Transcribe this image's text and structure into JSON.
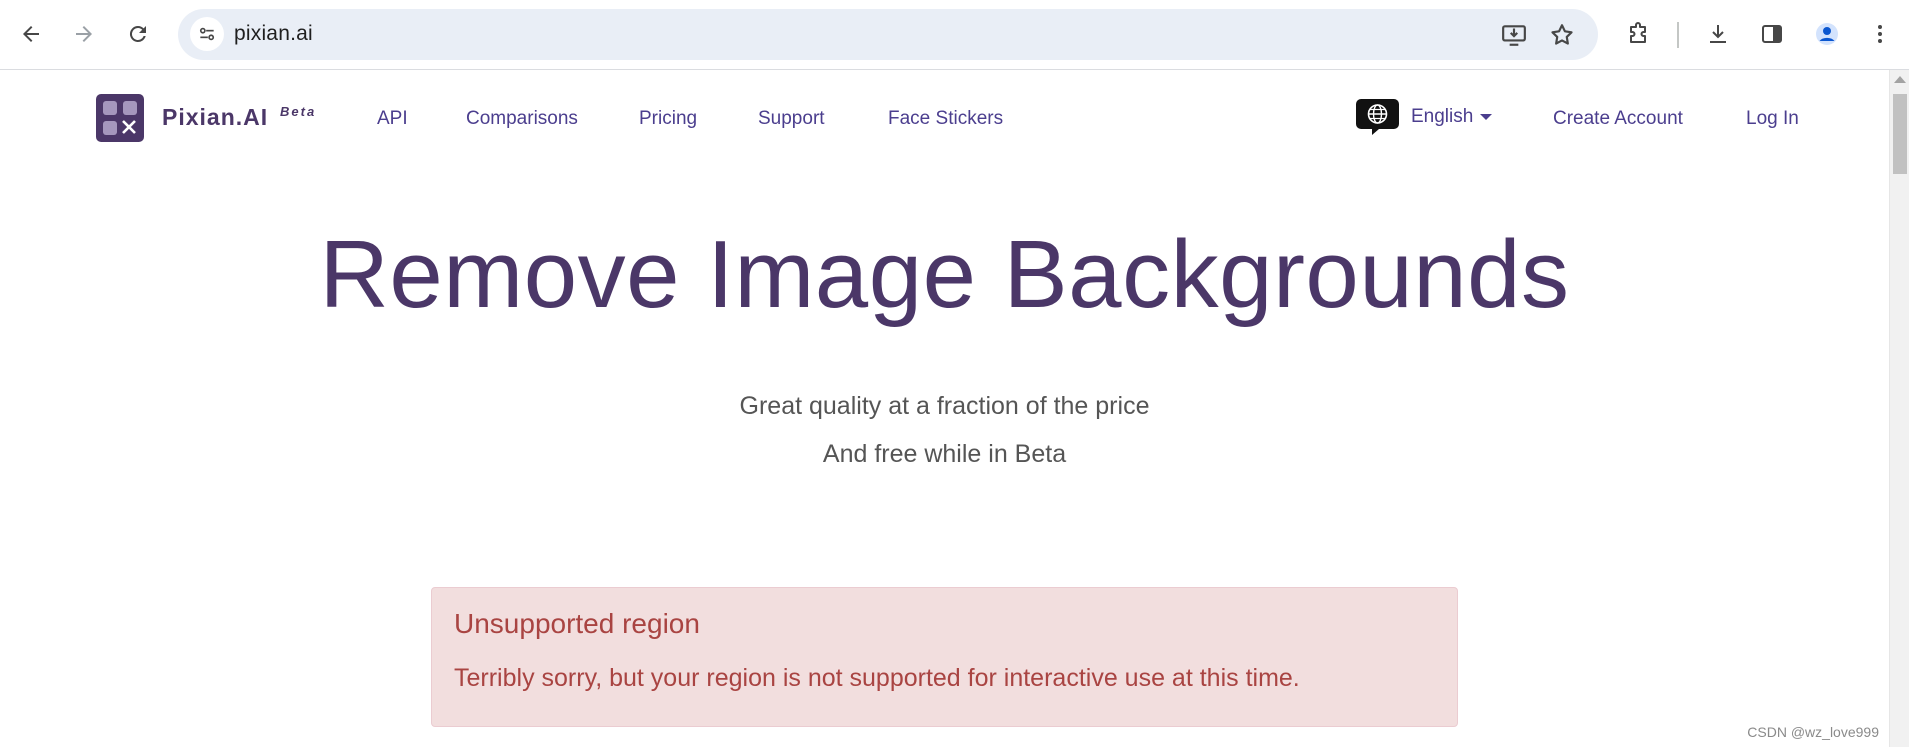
{
  "browser": {
    "url": "pixian.ai",
    "back_icon": "arrow-left-icon",
    "forward_icon": "arrow-right-icon",
    "reload_icon": "reload-icon"
  },
  "site": {
    "brand": "Pixian.AI",
    "brand_badge": "Beta",
    "nav": {
      "api": "API",
      "comparisons": "Comparisons",
      "pricing": "Pricing",
      "support": "Support",
      "face_stickers": "Face Stickers"
    },
    "language": "English",
    "create_account": "Create Account",
    "login": "Log In"
  },
  "hero": {
    "title": "Remove Image Backgrounds",
    "subtitle_1": "Great quality at a fraction of the price",
    "subtitle_2": "And free while in Beta"
  },
  "alert": {
    "title": "Unsupported region",
    "body": "Terribly sorry, but your region is not supported for interactive use at this time."
  },
  "watermark": "CSDN @wz_love999",
  "colors": {
    "brand": "#4b3768",
    "link": "#4b3e8e",
    "alert_bg": "#f2dede",
    "alert_text": "#a94442"
  }
}
